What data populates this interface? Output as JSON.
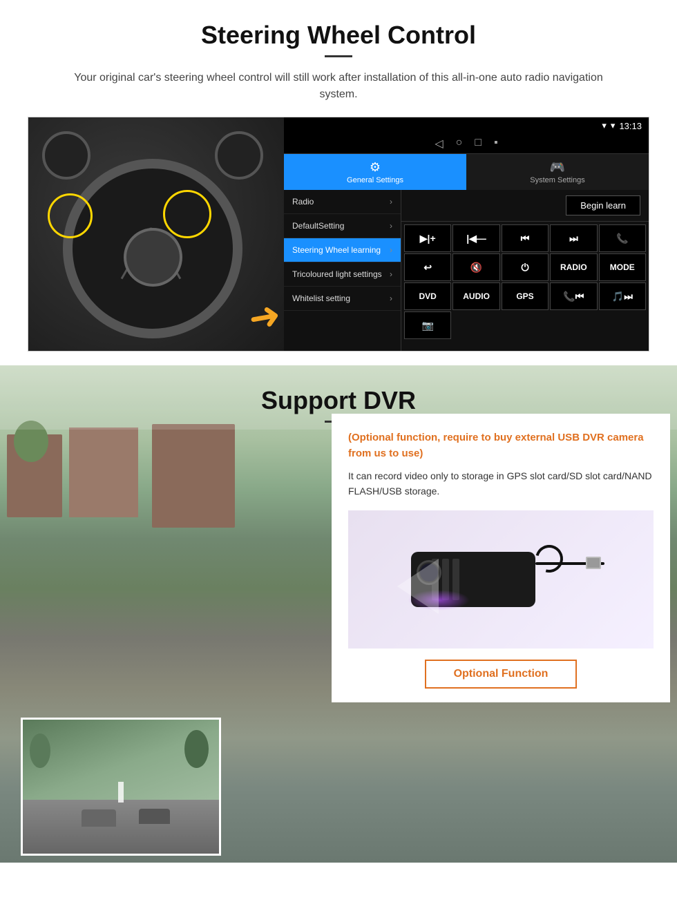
{
  "section1": {
    "title": "Steering Wheel Control",
    "description": "Your original car's steering wheel control will still work after installation of this all-in-one auto radio navigation system.",
    "android_ui": {
      "statusbar": {
        "signal_icon": "▼",
        "wifi_icon": "▼",
        "time": "13:13"
      },
      "nav_buttons": [
        "◁",
        "○",
        "□",
        "▪"
      ],
      "tabs": [
        {
          "icon": "⚙",
          "label": "General Settings",
          "active": true
        },
        {
          "icon": "🎮",
          "label": "System Settings",
          "active": false
        }
      ],
      "menu_items": [
        {
          "label": "Radio",
          "active": false
        },
        {
          "label": "DefaultSetting",
          "active": false
        },
        {
          "label": "Steering Wheel learning",
          "active": true
        },
        {
          "label": "Tricoloured light settings",
          "active": false
        },
        {
          "label": "Whitelist setting",
          "active": false
        }
      ],
      "begin_learn_button": "Begin learn",
      "button_grid": [
        [
          "▶◀+",
          "▶◀—",
          "⏮",
          "⏭",
          "📞"
        ],
        [
          "↩",
          "🔊×",
          "⏻",
          "RADIO",
          "MODE"
        ],
        [
          "DVD",
          "AUDIO",
          "GPS",
          "📞⏮",
          "🎵⏭"
        ],
        [
          "📷"
        ]
      ]
    }
  },
  "section2": {
    "title": "Support DVR",
    "optional_text": "(Optional function, require to buy external USB DVR camera from us to use)",
    "description": "It can record video only to storage in GPS slot card/SD slot card/NAND FLASH/USB storage.",
    "optional_button_label": "Optional Function"
  }
}
